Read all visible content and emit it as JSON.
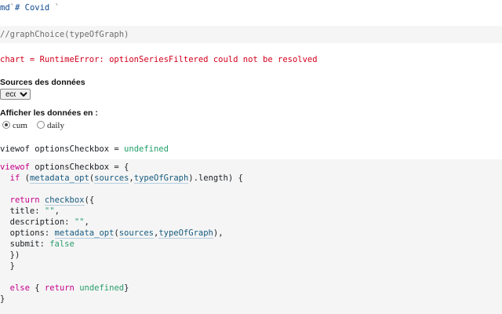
{
  "cells": {
    "md_line": {
      "prefix": "md",
      "tick_open": "`",
      "content": "# Covid ",
      "tick_close": "`"
    },
    "comment_line": "//graphChoice(typeOfGraph)",
    "error_line": "chart = RuntimeError: optionSeriesFiltered could not be resolved",
    "sources": {
      "label": "Sources des données",
      "select_value": "ecdc"
    },
    "display": {
      "label": "Afficher les données en :",
      "options": [
        "cum",
        "daily"
      ],
      "selected": "cum"
    },
    "viewof_result": {
      "prefix": "viewof optionsCheckbox = ",
      "value": "undefined"
    },
    "code": {
      "l1_kw": "viewof",
      "l1_rest": " optionsCheckbox = {",
      "l2_indent": "  ",
      "l2_if": "if",
      "l2_open": " (",
      "l2_fn": "metadata_opt",
      "l2_p1": "(",
      "l2_arg1": "sources",
      "l2_comma": ",",
      "l2_arg2": "typeOfGraph",
      "l2_tail": ").length) {",
      "l4_indent": "  ",
      "l4_return": "return",
      "l4_sp": " ",
      "l4_fn": "checkbox",
      "l4_tail": "({",
      "l5_text": "  title: ",
      "l5_str": "\"\"",
      "l5_tail": ",",
      "l6_text": "  description: ",
      "l6_str": "\"\"",
      "l6_tail": ",",
      "l7_text": "  options: ",
      "l7_fn": "metadata_opt",
      "l7_p1": "(",
      "l7_arg1": "sources",
      "l7_comma": ",",
      "l7_arg2": "typeOfGraph",
      "l7_tail": "),",
      "l8_text": "  submit: ",
      "l8_val": "false",
      "l9_text": "  })",
      "l10_text": "  }",
      "l12_indent": "  ",
      "l12_else": "else",
      "l12_mid": " { ",
      "l12_return": "return",
      "l12_sp": " ",
      "l12_undef": "undefined",
      "l12_tail": "}",
      "l13_text": "}"
    }
  },
  "colors": {
    "keyword": "#c5008c",
    "string": "#2a9d6d",
    "error": "#d2001c",
    "comment": "#6d6d6d",
    "reference": "#165a7e",
    "cell_background": "#f5f5f5"
  }
}
